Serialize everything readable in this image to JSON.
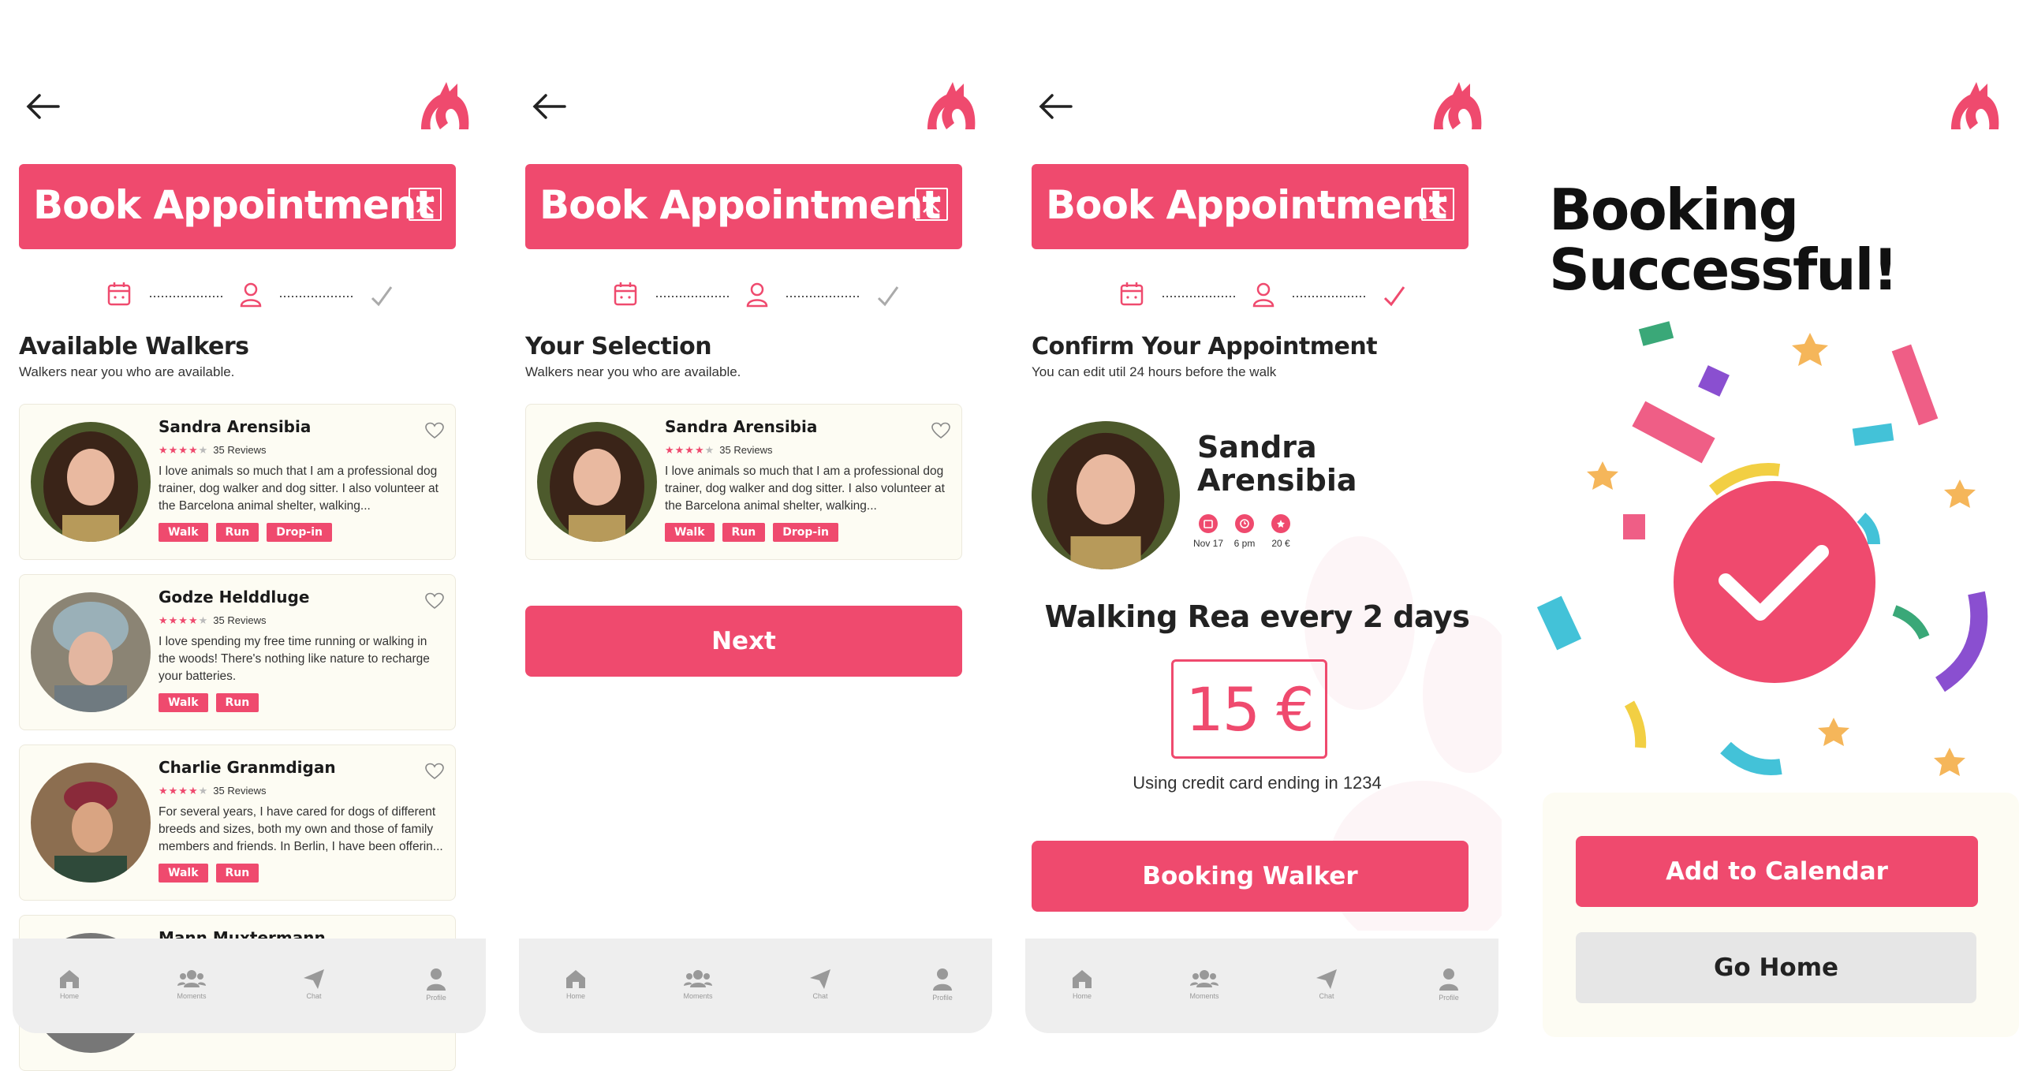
{
  "colors": {
    "accent": "#ef4a6e",
    "card_bg": "#fdfcf3",
    "nav_bg": "#eeeeee"
  },
  "common": {
    "title": "Book Appointment",
    "nav": [
      "Home",
      "Moments",
      "Chat",
      "Profile"
    ]
  },
  "screen1": {
    "section_title": "Available Walkers",
    "section_sub": "Walkers near you who are available.",
    "walkers": [
      {
        "name": "Sandra Arensibia",
        "rating": 4,
        "reviews": "35 Reviews",
        "bio": "I love animals so much that I am a professional dog trainer, dog walker and dog sitter. I also volunteer at the Barcelona animal shelter, walking...",
        "tags": [
          "Walk",
          "Run",
          "Drop-in"
        ]
      },
      {
        "name": "Godze Helddluge",
        "rating": 4,
        "reviews": "35 Reviews",
        "bio": "I love spending my free time running or walking in the woods! There's nothing like nature to recharge your batteries.",
        "tags": [
          "Walk",
          "Run"
        ]
      },
      {
        "name": "Charlie Granmdigan",
        "rating": 4,
        "reviews": "35 Reviews",
        "bio": "For several years, I have cared for dogs of different breeds and sizes, both my own and those of family members and friends. In Berlin, I have been offerin...",
        "tags": [
          "Walk",
          "Run"
        ]
      },
      {
        "name": "Mann Muxtermann"
      }
    ]
  },
  "screen2": {
    "section_title": "Your Selection",
    "section_sub": "Walkers near you who are available.",
    "walker": {
      "name": "Sandra Arensibia",
      "rating": 4,
      "reviews": "35 Reviews",
      "bio": "I love animals so much that I am a professional dog trainer, dog walker and dog sitter. I also volunteer at the Barcelona animal shelter, walking...",
      "tags": [
        "Walk",
        "Run",
        "Drop-in"
      ]
    },
    "next_label": "Next"
  },
  "screen3": {
    "section_title": "Confirm Your Appointment",
    "section_sub": "You can edit util 24 hours before the walk",
    "walker_name": "Sandra Arensibia",
    "meta": [
      {
        "icon": "calendar-icon",
        "label": "Nov 17"
      },
      {
        "icon": "clock-icon",
        "label": "6 pm"
      },
      {
        "icon": "euro-icon",
        "label": "20 €"
      }
    ],
    "walk_title": "Walking Rea every 2 days",
    "price": "15 €",
    "card_text": "Using credit card ending in 1234",
    "button_label": "Booking Walker"
  },
  "screen4": {
    "title_line1": "Booking",
    "title_line2": "Successful!",
    "calendar_label": "Add to Calendar",
    "home_label": "Go Home"
  }
}
